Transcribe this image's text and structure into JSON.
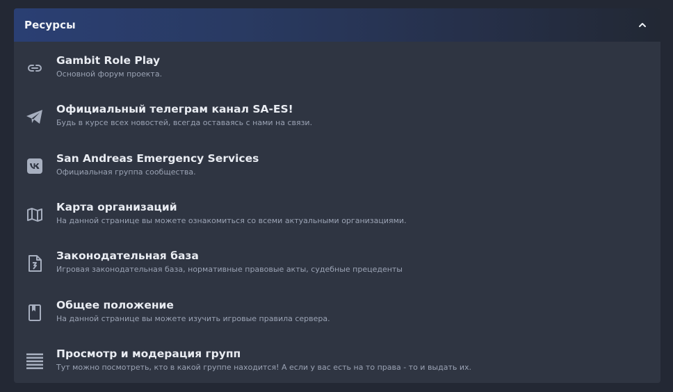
{
  "panel": {
    "title": "Ресурсы"
  },
  "items": [
    {
      "icon": "link-icon",
      "title": "Gambit Role Play",
      "description": "Основной форум проекта."
    },
    {
      "icon": "telegram-icon",
      "title": "Официальный телеграм канал SA-ES!",
      "description": "Будь в курсе всех новостей, всегда оставаясь с нами на связи."
    },
    {
      "icon": "vk-icon",
      "title": "San Andreas Emergency Services",
      "description": "Официальная группа сообщества."
    },
    {
      "icon": "map-icon",
      "title": "Карта организаций",
      "description": "На данной странице вы можете ознакомиться со всеми актуальными организациями."
    },
    {
      "icon": "document-icon",
      "title": "Законодательная база",
      "description": "Игровая законодательная база, нормативные правовые акты, судебные прецеденты"
    },
    {
      "icon": "book-icon",
      "title": "Общее положение",
      "description": "На данной странице вы можете изучить игровые правила сервера."
    },
    {
      "icon": "list-icon",
      "title": "Просмотр и модерация групп",
      "description": "Тут можно посмотреть, кто в какой группе находится! А если у вас есть на то права - то и выдать их."
    }
  ],
  "colors": {
    "background": "#232834",
    "panel": "#2f3542",
    "header_accent": "#2a3f73",
    "icon": "#a7afbf"
  }
}
